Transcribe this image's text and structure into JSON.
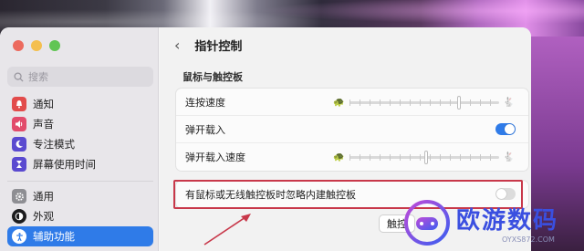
{
  "window": {
    "title": "指针控制"
  },
  "search": {
    "placeholder": "搜索"
  },
  "sidebar": {
    "items": [
      {
        "label": "通知",
        "icon": "bell-icon",
        "color": "#e24b4b"
      },
      {
        "label": "声音",
        "icon": "speaker-icon",
        "color": "#e24b6b"
      },
      {
        "label": "专注模式",
        "icon": "moon-icon",
        "color": "#5a4ad0"
      },
      {
        "label": "屏幕使用时间",
        "icon": "hourglass-icon",
        "color": "#5a4ad0"
      },
      {
        "label": "通用",
        "icon": "gear-icon",
        "color": "#8e8e93"
      },
      {
        "label": "外观",
        "icon": "appearance-icon",
        "color": "#1c1c1e"
      },
      {
        "label": "辅助功能",
        "icon": "accessibility-icon",
        "color": "#2f7be8",
        "active": true
      }
    ]
  },
  "section": {
    "title": "鼠标与触控板"
  },
  "settings": {
    "double_click_speed": {
      "label": "连按速度",
      "level": 0.72
    },
    "spring_loading": {
      "label": "弹开载入",
      "enabled": true
    },
    "spring_loading_speed": {
      "label": "弹开载入速度",
      "level": 0.5
    },
    "ignore_trackpad": {
      "label": "有鼠标或无线触控板时忽略内建触控板",
      "enabled": false
    }
  },
  "buttons": {
    "trackpad_options": "触控"
  },
  "watermark": {
    "title": "欧游数码",
    "subtitle": "OYXS872.COM"
  },
  "colors": {
    "accent": "#2f7be8",
    "highlight": "#c8384a"
  }
}
